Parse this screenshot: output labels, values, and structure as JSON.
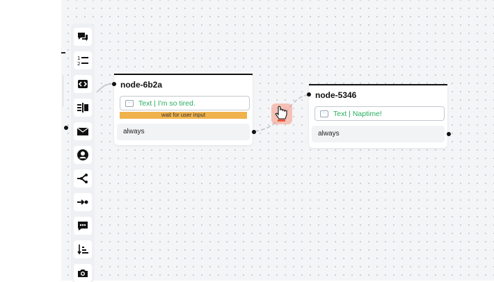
{
  "toolbar": {
    "tools": [
      {
        "icon": "chat-bubbles-icon"
      },
      {
        "icon": "numbered-list-icon"
      },
      {
        "icon": "code-block-icon"
      },
      {
        "icon": "split-columns-icon"
      },
      {
        "icon": "envelope-icon"
      },
      {
        "icon": "person-circle-icon"
      },
      {
        "icon": "branch-icon"
      },
      {
        "icon": "arrow-to-point-icon"
      },
      {
        "icon": "comment-dots-icon"
      },
      {
        "icon": "sort-descending-icon"
      },
      {
        "icon": "camera-icon"
      }
    ]
  },
  "nodes": [
    {
      "title": "node-6b2a",
      "message": "Text | I'm so tired.",
      "wait_label": "wait for user input",
      "condition": "always"
    },
    {
      "title": "node-5346",
      "message": "Text | Naptime!",
      "condition": "always"
    }
  ],
  "colors": {
    "message_text": "#27ae60",
    "wait_bar": "#f0b24c",
    "connector": "#c9ccd2",
    "cursor_badge": "#f59682"
  }
}
